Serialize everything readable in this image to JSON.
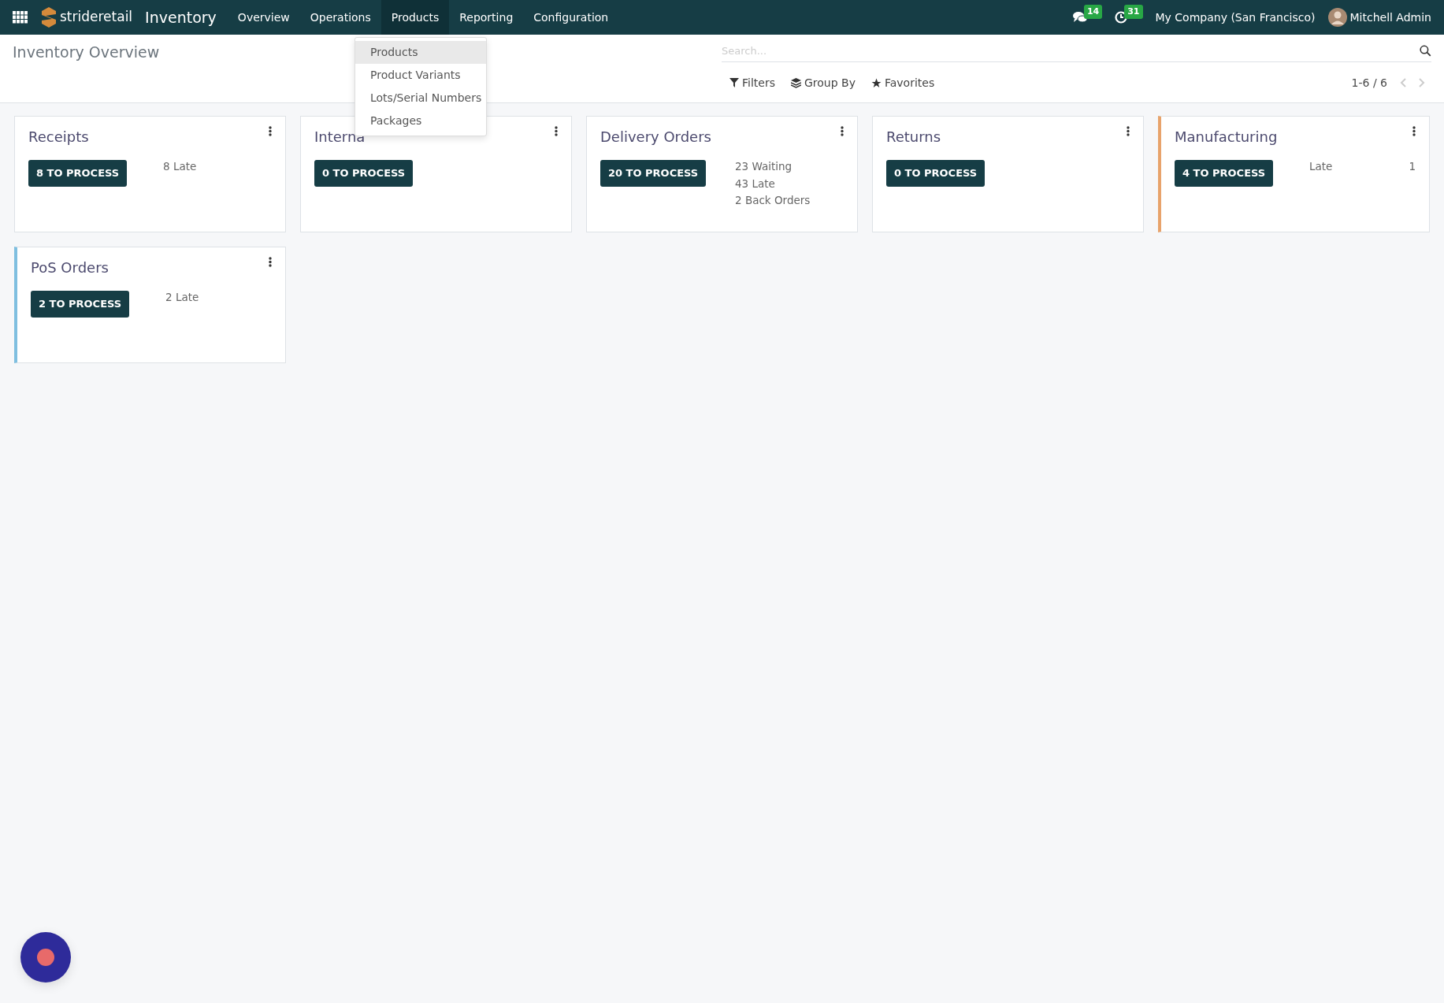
{
  "navbar": {
    "brand": "strideretail",
    "app": "Inventory",
    "menu": [
      {
        "label": "Overview",
        "selected": false
      },
      {
        "label": "Operations",
        "selected": false
      },
      {
        "label": "Products",
        "selected": true
      },
      {
        "label": "Reporting",
        "selected": false
      },
      {
        "label": "Configuration",
        "selected": false
      }
    ],
    "messages_count": "14",
    "activities_count": "31",
    "company": "My Company (San Francisco)",
    "user": "Mitchell Admin"
  },
  "dropdown": [
    {
      "label": "Products",
      "selected": true
    },
    {
      "label": "Product Variants",
      "selected": false
    },
    {
      "label": "Lots/Serial Numbers",
      "selected": false
    },
    {
      "label": "Packages",
      "selected": false
    }
  ],
  "page_title": "Inventory Overview",
  "search": {
    "placeholder": "Search..."
  },
  "filters": [
    "Filters",
    "Group By",
    "Favorites"
  ],
  "pager": "1-6 / 6",
  "cards": [
    {
      "title": "Receipts",
      "button": "8 TO PROCESS",
      "stats": [
        {
          "label": "8 Late"
        }
      ]
    },
    {
      "title": "Interna",
      "button": "0 TO PROCESS"
    },
    {
      "title": "Delivery Orders",
      "button": "20 TO PROCESS",
      "stats": [
        {
          "label": "23 Waiting"
        },
        {
          "label": "43 Late"
        },
        {
          "label": "2 Back Orders"
        }
      ]
    },
    {
      "title": "Returns",
      "button": "0 TO PROCESS"
    },
    {
      "title": "Manufacturing",
      "button": "4 TO PROCESS",
      "color": "#e8a36b",
      "stats": [
        {
          "label": "Late",
          "count": "1"
        }
      ]
    },
    {
      "title": "PoS Orders",
      "button": "2 TO PROCESS",
      "color": "#7fbfe0",
      "stats": [
        {
          "label": "2 Late"
        }
      ]
    }
  ]
}
